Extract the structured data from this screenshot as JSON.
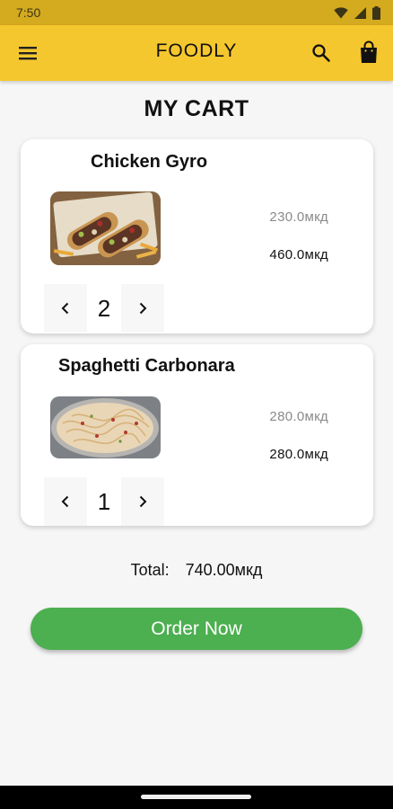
{
  "status_bar": {
    "time": "7:50"
  },
  "app_bar": {
    "title": "FOODLY"
  },
  "page": {
    "title": "MY CART"
  },
  "cart": {
    "items": [
      {
        "name": "Chicken Gyro",
        "unit_price": "230.0мкд",
        "line_total": "460.0мкд",
        "quantity": "2"
      },
      {
        "name": "Spaghetti Carbonara",
        "unit_price": "280.0мкд",
        "line_total": "280.0мкд",
        "quantity": "1"
      }
    ],
    "total_label": "Total:",
    "total_value": "740.00мкд"
  },
  "actions": {
    "order_label": "Order Now"
  },
  "colors": {
    "status_bar": "#d4aa1e",
    "app_bar": "#f5c72e",
    "order_button": "#4caf50",
    "background": "#f6f6f6"
  }
}
